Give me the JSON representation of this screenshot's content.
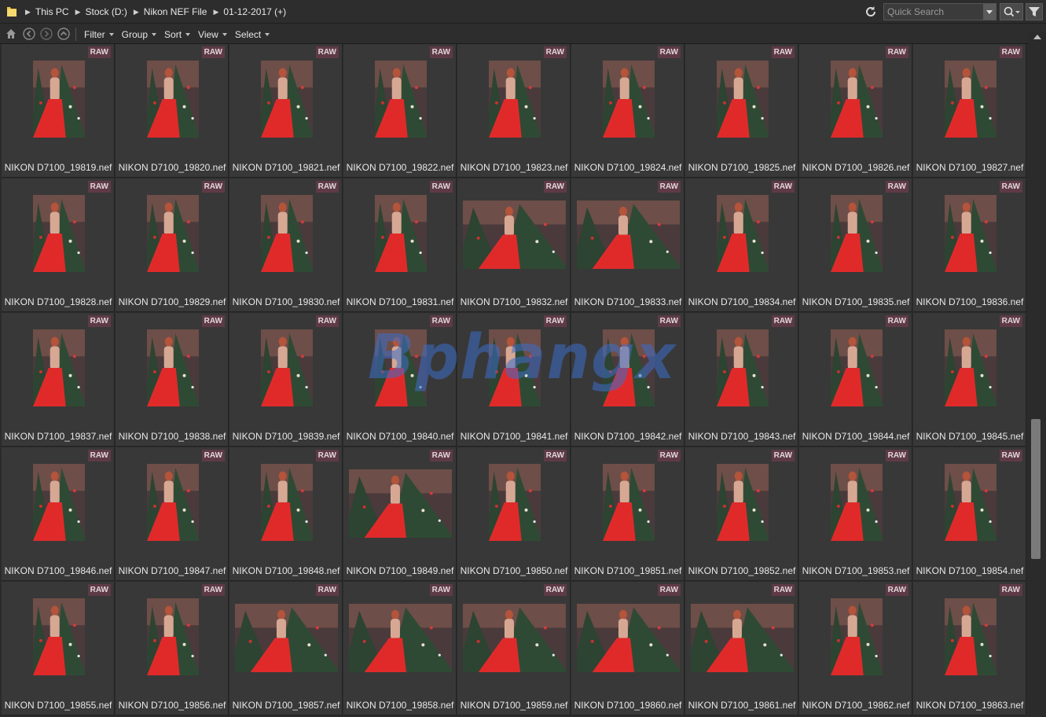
{
  "breadcrumbs": [
    "This PC",
    "Stock (D:)",
    "Nikon NEF File",
    "01-12-2017 (+)"
  ],
  "search": {
    "placeholder": "Quick Search"
  },
  "toolbar": {
    "menus": [
      "Filter",
      "Group",
      "Sort",
      "View",
      "Select"
    ]
  },
  "badge_label": "RAW",
  "colors": {
    "badge": "#5e3a47",
    "tile": "#383838",
    "background": "#2b2b2b"
  },
  "files": [
    {
      "name": "NIKON D7100_19819.nef",
      "orientation": "portrait"
    },
    {
      "name": "NIKON D7100_19820.nef",
      "orientation": "portrait"
    },
    {
      "name": "NIKON D7100_19821.nef",
      "orientation": "portrait"
    },
    {
      "name": "NIKON D7100_19822.nef",
      "orientation": "portrait"
    },
    {
      "name": "NIKON D7100_19823.nef",
      "orientation": "portrait"
    },
    {
      "name": "NIKON D7100_19824.nef",
      "orientation": "portrait"
    },
    {
      "name": "NIKON D7100_19825.nef",
      "orientation": "portrait"
    },
    {
      "name": "NIKON D7100_19826.nef",
      "orientation": "portrait"
    },
    {
      "name": "NIKON D7100_19827.nef",
      "orientation": "portrait"
    },
    {
      "name": "NIKON D7100_19828.nef",
      "orientation": "portrait"
    },
    {
      "name": "NIKON D7100_19829.nef",
      "orientation": "portrait"
    },
    {
      "name": "NIKON D7100_19830.nef",
      "orientation": "portrait"
    },
    {
      "name": "NIKON D7100_19831.nef",
      "orientation": "portrait"
    },
    {
      "name": "NIKON D7100_19832.nef",
      "orientation": "landscape"
    },
    {
      "name": "NIKON D7100_19833.nef",
      "orientation": "landscape"
    },
    {
      "name": "NIKON D7100_19834.nef",
      "orientation": "portrait"
    },
    {
      "name": "NIKON D7100_19835.nef",
      "orientation": "portrait"
    },
    {
      "name": "NIKON D7100_19836.nef",
      "orientation": "portrait"
    },
    {
      "name": "NIKON D7100_19837.nef",
      "orientation": "portrait"
    },
    {
      "name": "NIKON D7100_19838.nef",
      "orientation": "portrait"
    },
    {
      "name": "NIKON D7100_19839.nef",
      "orientation": "portrait"
    },
    {
      "name": "NIKON D7100_19840.nef",
      "orientation": "portrait"
    },
    {
      "name": "NIKON D7100_19841.nef",
      "orientation": "portrait"
    },
    {
      "name": "NIKON D7100_19842.nef",
      "orientation": "portrait"
    },
    {
      "name": "NIKON D7100_19843.nef",
      "orientation": "portrait"
    },
    {
      "name": "NIKON D7100_19844.nef",
      "orientation": "portrait"
    },
    {
      "name": "NIKON D7100_19845.nef",
      "orientation": "portrait"
    },
    {
      "name": "NIKON D7100_19846.nef",
      "orientation": "portrait"
    },
    {
      "name": "NIKON D7100_19847.nef",
      "orientation": "portrait"
    },
    {
      "name": "NIKON D7100_19848.nef",
      "orientation": "portrait"
    },
    {
      "name": "NIKON D7100_19849.nef",
      "orientation": "landscape"
    },
    {
      "name": "NIKON D7100_19850.nef",
      "orientation": "portrait"
    },
    {
      "name": "NIKON D7100_19851.nef",
      "orientation": "portrait"
    },
    {
      "name": "NIKON D7100_19852.nef",
      "orientation": "portrait"
    },
    {
      "name": "NIKON D7100_19853.nef",
      "orientation": "portrait"
    },
    {
      "name": "NIKON D7100_19854.nef",
      "orientation": "portrait"
    },
    {
      "name": "NIKON D7100_19855.nef",
      "orientation": "portrait"
    },
    {
      "name": "NIKON D7100_19856.nef",
      "orientation": "portrait"
    },
    {
      "name": "NIKON D7100_19857.nef",
      "orientation": "landscape"
    },
    {
      "name": "NIKON D7100_19858.nef",
      "orientation": "landscape"
    },
    {
      "name": "NIKON D7100_19859.nef",
      "orientation": "landscape"
    },
    {
      "name": "NIKON D7100_19860.nef",
      "orientation": "landscape"
    },
    {
      "name": "NIKON D7100_19861.nef",
      "orientation": "landscape"
    },
    {
      "name": "NIKON D7100_19862.nef",
      "orientation": "portrait"
    },
    {
      "name": "NIKON D7100_19863.nef",
      "orientation": "portrait"
    }
  ],
  "watermark": "Bphangx",
  "icons": {
    "folder": "folder-icon",
    "refresh": "refresh-icon",
    "search": "search-icon",
    "filter": "funnel-icon",
    "home": "home-icon",
    "back": "back-arrow-icon",
    "forward": "forward-arrow-icon",
    "up": "up-arrow-icon"
  }
}
